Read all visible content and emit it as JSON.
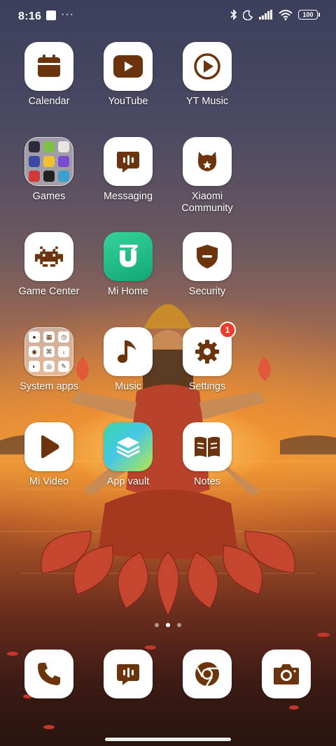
{
  "status_bar": {
    "time": "8:16",
    "battery": "100"
  },
  "apps": [
    {
      "label": "Calendar",
      "icon": "calendar-icon"
    },
    {
      "label": "YouTube",
      "icon": "youtube-icon"
    },
    {
      "label": "YT Music",
      "icon": "yt-music-icon"
    },
    {
      "label": "Games",
      "icon": "games-folder-icon"
    },
    {
      "label": "Messaging",
      "icon": "messaging-icon"
    },
    {
      "label": "Xiaomi\nCommunity",
      "icon": "xiaomi-community-icon"
    },
    {
      "label": "Game Center",
      "icon": "game-center-icon"
    },
    {
      "label": "Mi Home",
      "icon": "mi-home-icon"
    },
    {
      "label": "Security",
      "icon": "security-shield-icon"
    },
    {
      "label": "System apps",
      "icon": "system-apps-folder-icon"
    },
    {
      "label": "Music",
      "icon": "music-note-icon"
    },
    {
      "label": "Settings",
      "icon": "settings-gear-icon",
      "badge": "1"
    },
    {
      "label": "Mi Video",
      "icon": "mi-video-icon"
    },
    {
      "label": "App vault",
      "icon": "app-vault-icon"
    },
    {
      "label": "Notes",
      "icon": "notes-icon"
    }
  ],
  "dock": [
    {
      "icon": "phone-icon"
    },
    {
      "icon": "messaging-icon"
    },
    {
      "icon": "chrome-icon"
    },
    {
      "icon": "camera-icon"
    }
  ],
  "pager": {
    "pages": 3,
    "active": 1
  },
  "colors": {
    "icon_brown": "#6b340c",
    "badge_red": "#ee3a2c",
    "mi_home_green": "#1fbf87"
  }
}
